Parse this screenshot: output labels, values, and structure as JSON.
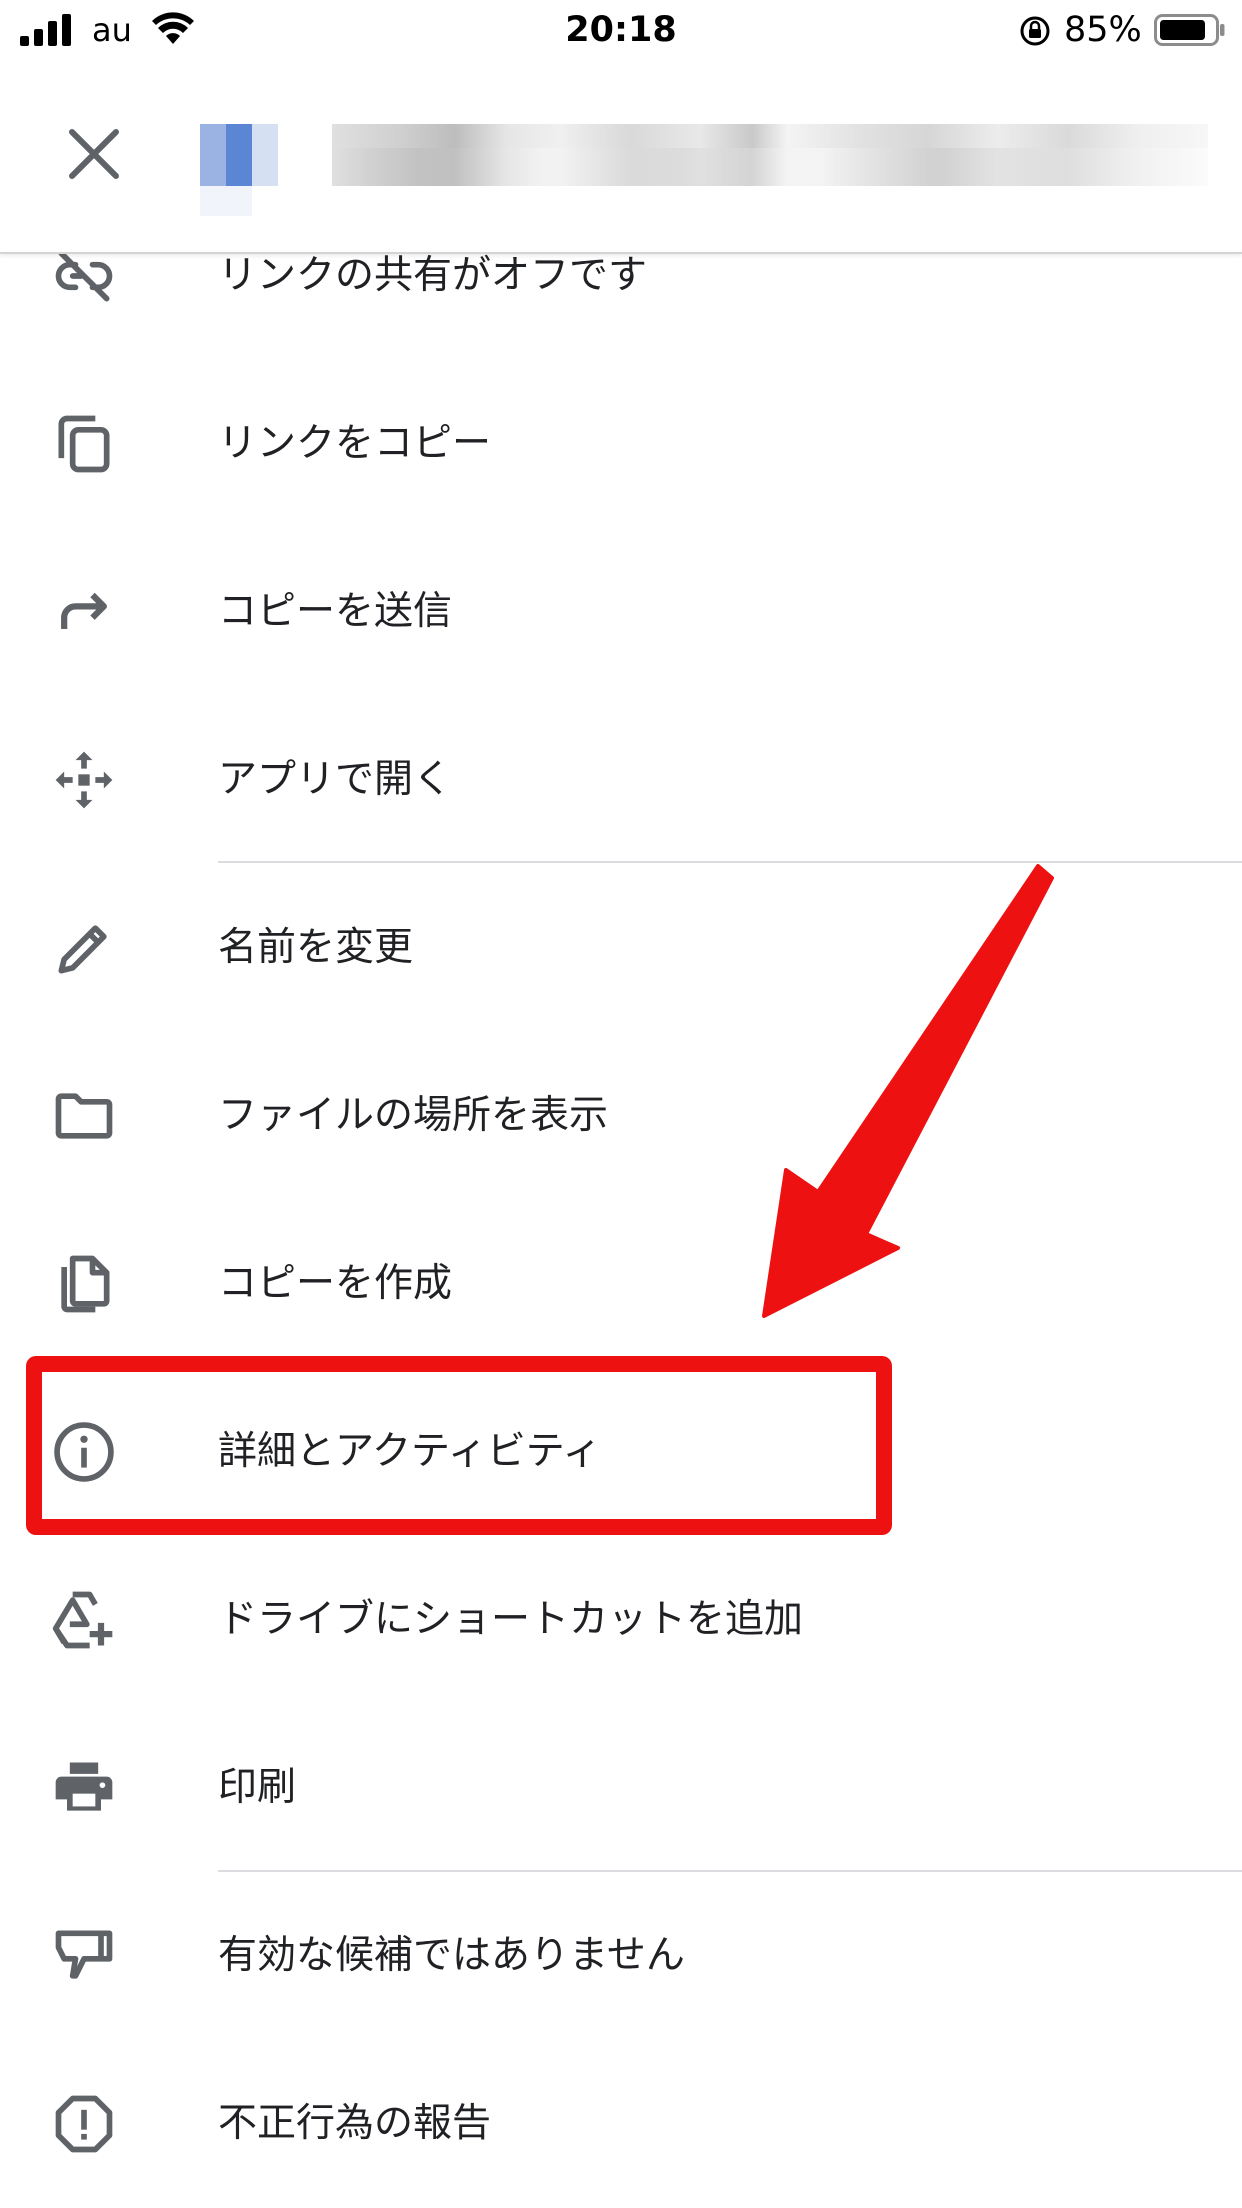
{
  "status_bar": {
    "carrier": "au",
    "time": "20:18",
    "battery_percent": "85%",
    "battery_level": 0.85
  },
  "header": {
    "close_icon": "close-icon",
    "file_name": "",
    "file_name_obscured": true
  },
  "menu": {
    "items": [
      {
        "label": "リンクの共有がオフです",
        "icon": "link-off-icon"
      },
      {
        "label": "リンクをコピー",
        "icon": "copy-icon"
      },
      {
        "label": "コピーを送信",
        "icon": "share-arrow-icon"
      },
      {
        "label": "アプリで開く",
        "icon": "open-with-icon"
      },
      {
        "label": "名前を変更",
        "icon": "pencil-icon"
      },
      {
        "label": "ファイルの場所を表示",
        "icon": "folder-icon"
      },
      {
        "label": "コピーを作成",
        "icon": "file-copy-icon"
      },
      {
        "label": "詳細とアクティビティ",
        "icon": "info-icon",
        "highlighted": true
      },
      {
        "label": "ドライブにショートカットを追加",
        "icon": "drive-shortcut-add-icon"
      },
      {
        "label": "印刷",
        "icon": "print-icon"
      },
      {
        "label": "有効な候補ではありません",
        "icon": "thumb-down-icon"
      },
      {
        "label": "不正行為の報告",
        "icon": "report-icon"
      }
    ]
  },
  "annotation": {
    "highlight_color": "#ee1111"
  }
}
